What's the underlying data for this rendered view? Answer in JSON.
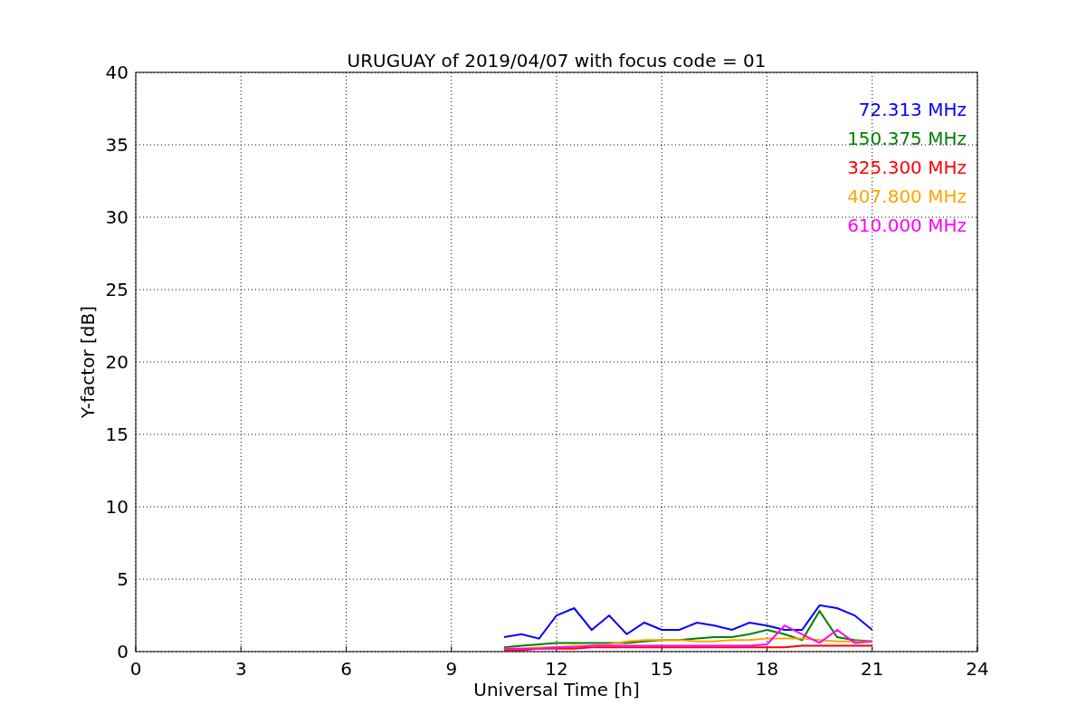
{
  "chart_data": {
    "type": "line",
    "title": "URUGUAY of 2019/04/07 with focus code = 01",
    "xlabel": "Universal Time [h]",
    "ylabel": "Y-factor [dB]",
    "x": [
      10.5,
      11,
      11.5,
      12,
      12.5,
      13,
      13.5,
      14,
      14.5,
      15,
      15.5,
      16,
      16.5,
      17,
      17.5,
      18,
      18.5,
      19,
      19.5,
      20,
      20.5,
      21
    ],
    "series": [
      {
        "name": "72.313 MHz",
        "color": "#0000ff",
        "values": [
          1.0,
          1.2,
          0.9,
          2.5,
          3.0,
          1.5,
          2.5,
          1.2,
          2.0,
          1.5,
          1.5,
          2.0,
          1.8,
          1.5,
          2.0,
          1.8,
          1.5,
          1.5,
          3.2,
          3.0,
          2.5,
          1.5
        ]
      },
      {
        "name": "150.375 MHz",
        "color": "#008000",
        "values": [
          0.3,
          0.4,
          0.5,
          0.6,
          0.6,
          0.6,
          0.6,
          0.6,
          0.7,
          0.8,
          0.8,
          0.9,
          1.0,
          1.0,
          1.2,
          1.5,
          1.2,
          0.8,
          2.8,
          1.0,
          0.8,
          0.7
        ]
      },
      {
        "name": "325.300 MHz",
        "color": "#ff0000",
        "values": [
          0.1,
          0.1,
          0.2,
          0.2,
          0.2,
          0.3,
          0.3,
          0.3,
          0.3,
          0.3,
          0.3,
          0.3,
          0.3,
          0.3,
          0.3,
          0.3,
          0.3,
          0.4,
          0.4,
          0.4,
          0.4,
          0.4
        ]
      },
      {
        "name": "407.800 MHz",
        "color": "#ffa500",
        "values": [
          0.2,
          0.2,
          0.3,
          0.3,
          0.4,
          0.4,
          0.5,
          0.7,
          0.8,
          0.8,
          0.8,
          0.7,
          0.7,
          0.8,
          0.8,
          0.9,
          0.9,
          0.9,
          0.8,
          0.7,
          0.7,
          0.7
        ]
      },
      {
        "name": "610.000 MHz",
        "color": "#ff00ff",
        "values": [
          0.2,
          0.2,
          0.2,
          0.3,
          0.3,
          0.4,
          0.4,
          0.4,
          0.4,
          0.4,
          0.4,
          0.4,
          0.4,
          0.4,
          0.4,
          0.5,
          1.8,
          1.2,
          0.6,
          1.5,
          0.6,
          0.7
        ]
      }
    ],
    "xlim": [
      0,
      24
    ],
    "ylim": [
      0,
      40
    ],
    "xticks": [
      0,
      3,
      6,
      9,
      12,
      15,
      18,
      21,
      24
    ],
    "yticks": [
      0,
      5,
      10,
      15,
      20,
      25,
      30,
      35,
      40
    ],
    "grid": true
  }
}
